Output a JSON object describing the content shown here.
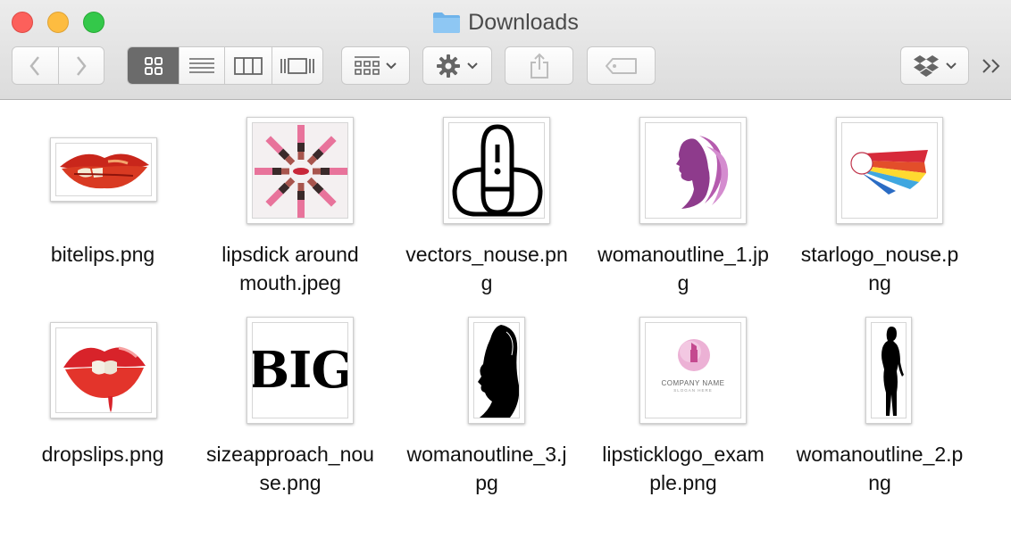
{
  "window": {
    "title": "Downloads"
  },
  "toolbar": {
    "icons": [
      "back-arrow-icon",
      "forward-arrow-icon",
      "grid-view-icon",
      "list-view-icon",
      "column-view-icon",
      "cover-flow-icon",
      "arrange-icon",
      "gear-icon",
      "share-icon",
      "tag-icon",
      "dropbox-icon",
      "more-icon"
    ]
  },
  "files": [
    {
      "name": "bitelips.png",
      "line1": "bitelips.png",
      "line2": ""
    },
    {
      "name": "lipsdick around mouth.jpeg",
      "line1": "lipsdick around",
      "line2": "mouth.jpeg"
    },
    {
      "name": "vectors_nouse.png",
      "line1": "vectors_nouse.pn",
      "line2": "g"
    },
    {
      "name": "womanoutline_1.jpg",
      "line1": "womanoutline_1.jp",
      "line2": "g"
    },
    {
      "name": "starlogo_nouse.png",
      "line1": "starlogo_nouse.p",
      "line2": "ng"
    },
    {
      "name": "dropslips.png",
      "line1": "dropslips.png",
      "line2": ""
    },
    {
      "name": "sizeapproach_nouse.png",
      "line1": "sizeapproach_nou",
      "line2": "se.png"
    },
    {
      "name": "womanoutline_3.jpg",
      "line1": "womanoutline_3.j",
      "line2": "pg"
    },
    {
      "name": "lipsticklogo_example.png",
      "line1": "lipsticklogo_exam",
      "line2": "ple.png"
    },
    {
      "name": "womanoutline_2.png",
      "line1": "womanoutline_2.p",
      "line2": "ng"
    }
  ],
  "thumb_text": {
    "big_logo": "BIG",
    "company_name": "COMPANY NAME",
    "slogan": "SLOGAN HERE"
  }
}
